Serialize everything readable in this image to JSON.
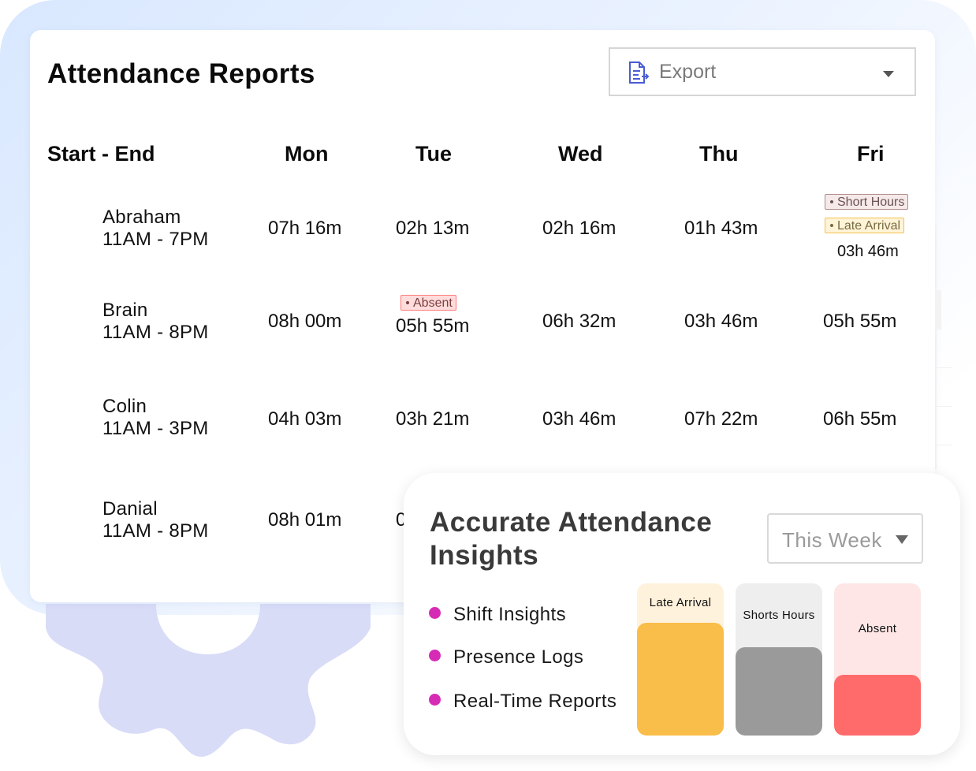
{
  "report": {
    "title": "Attendance Reports",
    "export_label": "Export",
    "columns": [
      "Start - End",
      "Mon",
      "Tue",
      "Wed",
      "Thu",
      "Fri"
    ],
    "rows": [
      {
        "name": "Abraham",
        "shift": "11AM  -  7PM",
        "mon": "07h 16m",
        "tue": "02h 13m",
        "wed": "02h 16m",
        "thu": "01h 43m",
        "fri": "03h 46m"
      },
      {
        "name": "Brain",
        "shift": "11AM  -  8PM",
        "mon": "08h 00m",
        "tue": "05h 55m",
        "wed": "06h 32m",
        "thu": "03h 46m",
        "fri": "05h 55m"
      },
      {
        "name": "Colin",
        "shift": "11AM  -  3PM",
        "mon": "04h 03m",
        "tue": "03h 21m",
        "wed": "03h 46m",
        "thu": "07h 22m",
        "fri": "06h 55m"
      },
      {
        "name": "Danial",
        "shift": "11AM  -  8PM",
        "mon": "08h 01m",
        "tue": "0"
      }
    ],
    "badges": {
      "short_hours": "Short Hours",
      "late_arrival": "Late Arrival",
      "absent": "Absent"
    }
  },
  "insights": {
    "title": "Accurate Attendance Insights",
    "range_select": "This Week",
    "bullets": [
      "Shift Insights",
      "Presence Logs",
      "Real-Time Reports"
    ],
    "bullet_color": "#d62cb5",
    "bars": [
      {
        "label": "Late Arrival",
        "level": 0.74,
        "fill": "#f9bd4a",
        "track": "#fff2dc"
      },
      {
        "label": "Shorts Hours",
        "level": 0.58,
        "fill": "#9a9a9a",
        "track": "#eeeeee"
      },
      {
        "label": "Absent",
        "level": 0.4,
        "fill": "#ff6b6b",
        "track": "#ffe6e6"
      }
    ]
  },
  "icons": {
    "export": "document-export-icon",
    "dropdown": "caret-down-icon",
    "decor": "gear-shape"
  },
  "colors": {
    "accent_blue": "#4a5bd6",
    "gear": "#d8dcf7"
  }
}
